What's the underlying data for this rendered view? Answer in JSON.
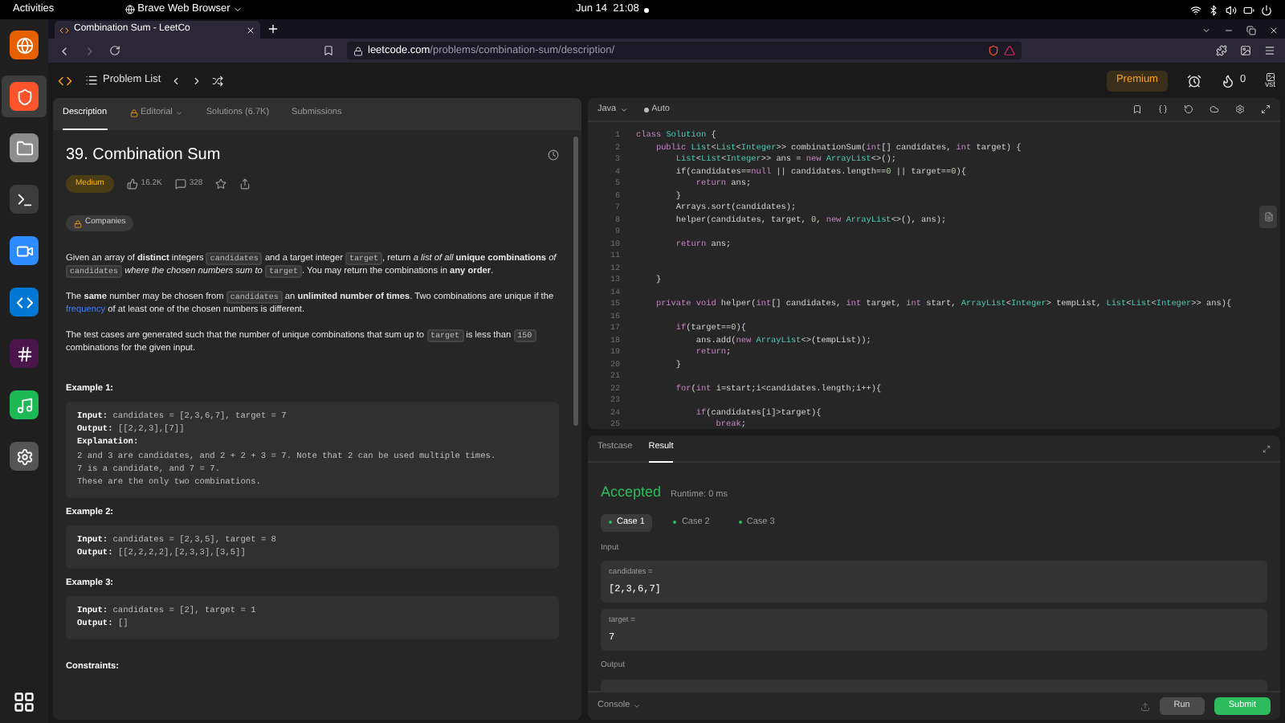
{
  "system_bar": {
    "activities": "Activities",
    "app_menu": "Brave Web Browser",
    "clock": "Jun 14  21:08"
  },
  "dock": {
    "apps": [
      {
        "kind": "firefox",
        "selected": false
      },
      {
        "kind": "brave",
        "selected": true
      },
      {
        "kind": "files",
        "selected": false
      },
      {
        "kind": "terminal",
        "selected": false
      },
      {
        "kind": "zoom",
        "selected": false
      },
      {
        "kind": "vscode",
        "selected": false
      },
      {
        "kind": "slack",
        "selected": false
      },
      {
        "kind": "spotify",
        "selected": false
      },
      {
        "kind": "settings",
        "selected": false
      }
    ]
  },
  "browser": {
    "tab": {
      "title": "Combination Sum - LeetCo"
    },
    "url": {
      "domain": "leetcode.com",
      "path": "/problems/combination-sum/description/"
    }
  },
  "nav": {
    "problem_list": "Problem List",
    "premium": "Premium",
    "streak": "0",
    "avatar_alt": "vst"
  },
  "description": {
    "tabs": [
      {
        "label": "Description",
        "selected": true,
        "locked": false
      },
      {
        "label": "Editorial",
        "selected": false,
        "locked": true
      },
      {
        "label": "Solutions (6.7K)",
        "selected": false,
        "locked": false
      },
      {
        "label": "Submissions",
        "selected": false,
        "locked": false
      }
    ],
    "title": "39. Combination Sum",
    "difficulty": "Medium",
    "likes": "16.2K",
    "dislikes": "328",
    "companies": "Companies",
    "paragraphs": [
      [
        {
          "kind": "text",
          "text": "Given an array of **distinct** integers "
        },
        {
          "kind": "code",
          "text": "candidates"
        },
        {
          "kind": "text",
          "text": " and a target integer "
        },
        {
          "kind": "code",
          "text": "target"
        },
        {
          "kind": "text",
          "text": ", return *a list of all* **unique combinations** *of* "
        },
        {
          "kind": "code",
          "text": "candidates"
        },
        {
          "kind": "text",
          "text": " *where the chosen numbers sum to* "
        },
        {
          "kind": "code",
          "text": "target"
        },
        {
          "kind": "text",
          "text": ". You may return the combinations in **any order**."
        }
      ],
      [
        {
          "kind": "text",
          "text": "The **same** number may be chosen from "
        },
        {
          "kind": "code",
          "text": "candidates"
        },
        {
          "kind": "text",
          "text": " an **unlimited number of times**. Two combinations are unique if the "
        },
        {
          "kind": "link",
          "text": "frequency"
        },
        {
          "kind": "text",
          "text": " of at least one of the chosen numbers is different."
        }
      ],
      [
        {
          "kind": "text",
          "text": "The test cases are generated such that the number of unique combinations that sum up to "
        },
        {
          "kind": "code",
          "text": "target"
        },
        {
          "kind": "text",
          "text": " is less than "
        },
        {
          "kind": "code",
          "text": "150"
        },
        {
          "kind": "text",
          "text": " combinations for the given input."
        }
      ]
    ],
    "examples": [
      {
        "heading": "Example 1:",
        "lines": [
          "**Input:** candidates = [2,3,6,7], target = 7",
          "**Output:** [[2,2,3],[7]]",
          "**Explanation:**",
          "2 and 3 are candidates, and 2 + 2 + 3 = 7. Note that 2 can be used multiple times.",
          "7 is a candidate, and 7 = 7.",
          "These are the only two combinations."
        ]
      },
      {
        "heading": "Example 2:",
        "lines": [
          "**Input:** candidates = [2,3,5], target = 8",
          "**Output:** [[2,2,2,2],[2,3,3],[3,5]]"
        ]
      },
      {
        "heading": "Example 3:",
        "lines": [
          "**Input:** candidates = [2], target = 1",
          "**Output:** []"
        ]
      }
    ],
    "constraints_heading": "Constraints:"
  },
  "editor": {
    "language": "Java",
    "autocomplete": "Auto",
    "lines": [
      {
        "number": "1",
        "tokens": [
          {
            "kind": "keyword",
            "text": "class "
          },
          {
            "kind": "type",
            "text": "Solution"
          },
          {
            "kind": "plain",
            "text": " {"
          }
        ]
      },
      {
        "number": "2",
        "tokens": [
          {
            "kind": "keyword",
            "text": "    public "
          },
          {
            "kind": "type",
            "text": "List"
          },
          {
            "kind": "plain",
            "text": "<"
          },
          {
            "kind": "type",
            "text": "List"
          },
          {
            "kind": "plain",
            "text": "<"
          },
          {
            "kind": "type",
            "text": "Integer"
          },
          {
            "kind": "plain",
            "text": ">> combinationSum("
          },
          {
            "kind": "keyword",
            "text": "int"
          },
          {
            "kind": "plain",
            "text": "[] candidates, "
          },
          {
            "kind": "keyword",
            "text": "int"
          },
          {
            "kind": "plain",
            "text": " target) {"
          }
        ]
      },
      {
        "number": "3",
        "tokens": [
          {
            "kind": "type",
            "text": "        List"
          },
          {
            "kind": "plain",
            "text": "<"
          },
          {
            "kind": "type",
            "text": "List"
          },
          {
            "kind": "plain",
            "text": "<"
          },
          {
            "kind": "type",
            "text": "Integer"
          },
          {
            "kind": "plain",
            "text": ">> ans = "
          },
          {
            "kind": "keyword",
            "text": "new "
          },
          {
            "kind": "type",
            "text": "ArrayList"
          },
          {
            "kind": "plain",
            "text": "<>();"
          }
        ]
      },
      {
        "number": "4",
        "tokens": [
          {
            "kind": "plain",
            "text": "        if(candidates=="
          },
          {
            "kind": "keyword",
            "text": "null"
          },
          {
            "kind": "plain",
            "text": " || candidates.length=="
          },
          {
            "kind": "number",
            "text": "0"
          },
          {
            "kind": "plain",
            "text": " || target=="
          },
          {
            "kind": "number",
            "text": "0"
          },
          {
            "kind": "plain",
            "text": "){"
          }
        ]
      },
      {
        "number": "5",
        "tokens": [
          {
            "kind": "keyword",
            "text": "            return"
          },
          {
            "kind": "plain",
            "text": " ans;"
          }
        ]
      },
      {
        "number": "6",
        "tokens": [
          {
            "kind": "plain",
            "text": "        }"
          }
        ]
      },
      {
        "number": "7",
        "tokens": [
          {
            "kind": "plain",
            "text": "        Arrays.sort(candidates);"
          }
        ]
      },
      {
        "number": "8",
        "tokens": [
          {
            "kind": "plain",
            "text": "        helper(candidates, target, "
          },
          {
            "kind": "number",
            "text": "0"
          },
          {
            "kind": "plain",
            "text": ", "
          },
          {
            "kind": "keyword",
            "text": "new "
          },
          {
            "kind": "type",
            "text": "ArrayList"
          },
          {
            "kind": "plain",
            "text": "<>(), ans);"
          }
        ]
      },
      {
        "number": "9"
      },
      {
        "number": "10",
        "tokens": [
          {
            "kind": "keyword",
            "text": "        return"
          },
          {
            "kind": "plain",
            "text": " ans;"
          }
        ]
      },
      {
        "number": "11"
      },
      {
        "number": "12"
      },
      {
        "number": "13",
        "tokens": [
          {
            "kind": "plain",
            "text": "    }"
          }
        ]
      },
      {
        "number": "14"
      },
      {
        "number": "15",
        "tokens": [
          {
            "kind": "keyword",
            "text": "    private void "
          },
          {
            "kind": "plain",
            "text": "helper("
          },
          {
            "kind": "keyword",
            "text": "int"
          },
          {
            "kind": "plain",
            "text": "[] candidates, "
          },
          {
            "kind": "keyword",
            "text": "int"
          },
          {
            "kind": "plain",
            "text": " target, "
          },
          {
            "kind": "keyword",
            "text": "int"
          },
          {
            "kind": "plain",
            "text": " start, "
          },
          {
            "kind": "type",
            "text": "ArrayList"
          },
          {
            "kind": "plain",
            "text": "<"
          },
          {
            "kind": "type",
            "text": "Integer"
          },
          {
            "kind": "plain",
            "text": "> tempList, "
          },
          {
            "kind": "type",
            "text": "List"
          },
          {
            "kind": "plain",
            "text": "<"
          },
          {
            "kind": "type",
            "text": "List"
          },
          {
            "kind": "plain",
            "text": "<"
          },
          {
            "kind": "type",
            "text": "Integer"
          },
          {
            "kind": "plain",
            "text": ">> ans){"
          }
        ]
      },
      {
        "number": "16"
      },
      {
        "number": "17",
        "tokens": [
          {
            "kind": "keyword",
            "text": "        if"
          },
          {
            "kind": "plain",
            "text": "(target=="
          },
          {
            "kind": "number",
            "text": "0"
          },
          {
            "kind": "plain",
            "text": "){"
          }
        ]
      },
      {
        "number": "18",
        "tokens": [
          {
            "kind": "plain",
            "text": "            ans.add("
          },
          {
            "kind": "keyword",
            "text": "new "
          },
          {
            "kind": "type",
            "text": "ArrayList"
          },
          {
            "kind": "plain",
            "text": "<>(tempList));"
          }
        ]
      },
      {
        "number": "19",
        "tokens": [
          {
            "kind": "keyword",
            "text": "            return"
          },
          {
            "kind": "plain",
            "text": ";"
          }
        ]
      },
      {
        "number": "20",
        "tokens": [
          {
            "kind": "plain",
            "text": "        }"
          }
        ]
      },
      {
        "number": "21"
      },
      {
        "number": "22",
        "tokens": [
          {
            "kind": "keyword",
            "text": "        for"
          },
          {
            "kind": "plain",
            "text": "("
          },
          {
            "kind": "keyword",
            "text": "int"
          },
          {
            "kind": "plain",
            "text": " i=start;i<candidates.length;i++){"
          }
        ]
      },
      {
        "number": "23"
      },
      {
        "number": "24",
        "tokens": [
          {
            "kind": "keyword",
            "text": "            if"
          },
          {
            "kind": "plain",
            "text": "(candidates[i]>target){"
          }
        ]
      },
      {
        "number": "25",
        "tokens": [
          {
            "kind": "keyword",
            "text": "                break"
          },
          {
            "kind": "plain",
            "text": ";"
          }
        ]
      }
    ]
  },
  "console": {
    "tabs": [
      {
        "label": "Testcase",
        "selected": false
      },
      {
        "label": "Result",
        "selected": true
      }
    ],
    "status": "Accepted",
    "runtime": "Runtime: 0 ms",
    "cases": [
      {
        "label": "Case 1",
        "selected": true,
        "passed": true
      },
      {
        "label": "Case 2",
        "selected": false,
        "passed": true
      },
      {
        "label": "Case 3",
        "selected": false,
        "passed": true
      }
    ],
    "input_label": "Input",
    "inputs": [
      {
        "name": "candidates =",
        "value": "[2,3,6,7]"
      },
      {
        "name": "target =",
        "value": "7"
      }
    ],
    "output_label": "Output",
    "toggle": "Console",
    "run": "Run",
    "submit": "Submit"
  }
}
